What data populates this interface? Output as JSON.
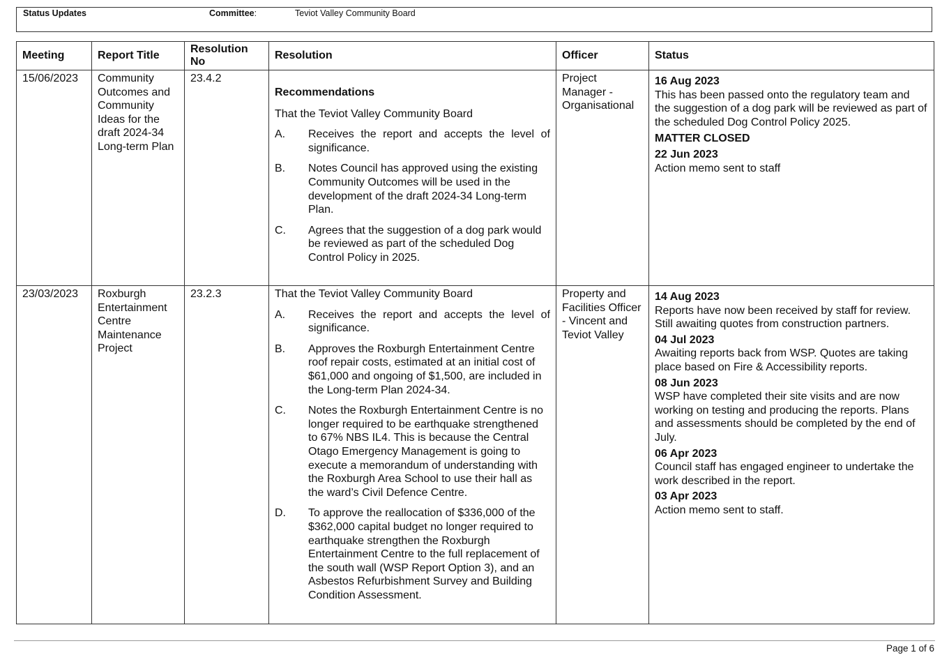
{
  "header": {
    "label_status": "Status Updates",
    "label_committee": "Committee",
    "colon": ":",
    "committee_value": "Teviot Valley Community Board"
  },
  "table": {
    "columns": [
      "Meeting",
      "Report Title",
      "Resolution No",
      "Resolution",
      "Officer",
      "Status"
    ],
    "rows": [
      {
        "meeting": "15/06/2023",
        "report_title": "Community Outcomes and Community Ideas for the draft 2024-34 Long-term Plan",
        "resolution_no": "23.4.2",
        "resolution_heading": "Recommendations",
        "resolution_intro": "That the Teviot Valley Community Board",
        "resolution_items": [
          {
            "letter": "A.",
            "text": "Receives the report and accepts the level of significance."
          },
          {
            "letter": "B.",
            "text": "Notes Council has approved using the existing Community Outcomes will be used in the development of the draft 2024-34 Long-term Plan."
          },
          {
            "letter": "C.",
            "text": "Agrees that the suggestion of a dog park would be reviewed as part of the scheduled Dog Control Policy in 2025."
          }
        ],
        "officer": "Project Manager - Organisational",
        "status": [
          {
            "date": "16 Aug 2023",
            "text": "This has been passed onto the regulatory team and the suggestion of a dog park will be reviewed as part of the scheduled Dog Control Policy 2025.",
            "note": "MATTER CLOSED"
          },
          {
            "date": "22 Jun 2023",
            "text": "Action memo sent to staff"
          }
        ]
      },
      {
        "meeting": "23/03/2023",
        "report_title": "Roxburgh Entertainment Centre Maintenance Project",
        "resolution_no": "23.2.3",
        "resolution_intro": "That the Teviot Valley Community Board",
        "resolution_items": [
          {
            "letter": "A.",
            "text": "Receives the report and accepts the level of significance."
          },
          {
            "letter": "B.",
            "text": "Approves the Roxburgh Entertainment Centre roof repair costs, estimated at an initial cost of $61,000 and ongoing of $1,500, are included in the Long-term Plan 2024-34."
          },
          {
            "letter": "C.",
            "text": "Notes the Roxburgh Entertainment Centre is no longer required to be earthquake strengthened to 67% NBS IL4. This is because the Central Otago Emergency Management is going to execute a memorandum of understanding with the Roxburgh Area School to use their hall as the ward’s Civil Defence Centre."
          },
          {
            "letter": "D.",
            "text": "To approve the reallocation of $336,000 of the $362,000 capital budget no longer required to earthquake strengthen the Roxburgh Entertainment Centre to the full replacement of the south wall (WSP Report Option 3), and an Asbestos Refurbishment Survey and Building Condition Assessment."
          }
        ],
        "officer": "Property and Facilities Officer - Vincent and Teviot Valley",
        "status": [
          {
            "date": "14 Aug 2023",
            "text": "Reports have now been received by staff for review. Still awaiting quotes from construction partners."
          },
          {
            "date": "04 Jul 2023",
            "text": "Awaiting reports back from WSP. Quotes are taking place based on Fire & Accessibility reports."
          },
          {
            "date": "08 Jun 2023",
            "text": "WSP have completed their site visits and are now working on testing and producing the reports. Plans and assessments should be completed by the end of July."
          },
          {
            "date": "06 Apr 2023",
            "text": "Council staff has engaged engineer to undertake the work described in the report."
          },
          {
            "date": "03 Apr 2023",
            "text": "Action memo sent to staff."
          }
        ]
      }
    ]
  },
  "footer": {
    "page": "Page 1 of 6"
  }
}
